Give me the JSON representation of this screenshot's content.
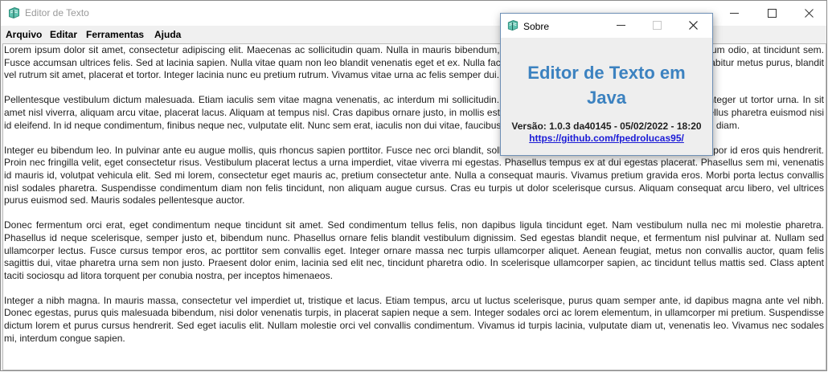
{
  "window": {
    "title": "Editor de Texto",
    "controls": {
      "minimize_icon": "minimize-icon",
      "maximize_icon": "maximize-icon",
      "close_icon": "close-icon"
    }
  },
  "menu": {
    "items": [
      "Arquivo",
      "Editar",
      "Ferramentas",
      "Ajuda"
    ]
  },
  "editor": {
    "paragraphs": [
      "Lorem ipsum dolor sit amet, consectetur adipiscing elit. Maecenas ac sollicitudin quam. Nulla in mauris bibendum, finibus libero in, maximus lorem. Sed et vestibulum odio, at tincidunt sem. Fusce accumsan ultrices felis. Sed at lacinia sapien. Nulla vitae quam non leo blandit venenatis eget et ex. Nulla facilisi. Vivamus iaculis semper maximus lorem. Curabitur metus purus, blandit vel rutrum sit amet, placerat et tortor. Integer lacinia nunc eu pretium rutrum. Vivamus vitae urna ac felis semper dui.",
      "Pellentesque vestibulum dictum malesuada. Etiam iaculis sem vitae magna venenatis, ac interdum mi sollicitudin. Nullam eu libero non dolor bibendum lobortis. Integer ut tortor urna. In sit amet nisl viverra, aliquam arcu vitae, placerat lacus. Aliquam at tempus nisl. Cras dapibus ornare justo, in mollis est. Aenean vel tellus mi. Phasellus mattis mi. Phasellus pharetra euismod nisi id eleifend. In id neque condimentum, finibus neque nec, vulputate elit. Nunc sem erat, iaculis non dui vitae, faucibus dignissim mi eros lectus. Pellentesque non mollis diam.",
      "Integer eu bibendum leo. In pulvinar ante eu augue mollis, quis rhoncus sapien porttitor. Fusce nec orci blandit, sollicitudin neque in, aliquam sem. Pellentesque tempor id eros quis hendrerit. Proin nec fringilla velit, eget consectetur risus. Vestibulum placerat lectus a urna imperdiet, vitae viverra mi egestas. Phasellus tempus ex at dui egestas placerat. Phasellus sem mi, venenatis id mauris id, volutpat vehicula elit. Sed mi lorem, consectetur eget mauris ac, pretium consectetur ante. Nulla a consequat mauris. Vivamus pretium gravida eros. Morbi porta lectus convallis nisl sodales pharetra. Suspendisse condimentum diam non felis tincidunt, non aliquam augue cursus. Cras eu turpis ut dolor scelerisque cursus. Aliquam consequat arcu libero, vel ultrices purus euismod sed. Mauris sodales pellentesque auctor.",
      "Donec fermentum orci erat, eget condimentum neque tincidunt sit amet. Sed condimentum tellus felis, non dapibus ligula tincidunt eget. Nam vestibulum nulla nec mi molestie pharetra. Phasellus id neque scelerisque, semper justo et, bibendum nunc. Phasellus ornare felis blandit vestibulum dignissim. Sed egestas blandit neque, et fermentum nisl pulvinar at. Nullam sed ullamcorper lectus. Fusce cursus tempor eros, ac porttitor sem convallis eget. Integer ornare massa nec turpis ullamcorper aliquet. Aenean feugiat, metus non convallis auctor, quam felis sagittis dui, vitae pharetra urna sem non justo. Praesent dolor enim, lacinia sed elit nec, tincidunt pharetra odio. In scelerisque ullamcorper sapien, ac tincidunt tellus mattis sed. Class aptent taciti sociosqu ad litora torquent per conubia nostra, per inceptos himenaeos.",
      "Integer a nibh magna. In mauris massa, consectetur vel imperdiet ut, tristique et lacus. Etiam tempus, arcu ut luctus scelerisque, purus quam semper ante, id dapibus magna ante vel nibh. Donec egestas, purus quis malesuada bibendum, nisi dolor venenatis turpis, in placerat sapien neque a sem. Integer sodales orci ac lorem elementum, in ullamcorper mi pretium. Suspendisse dictum lorem et purus cursus hendrerit. Sed eget iaculis elit. Nullam molestie orci vel convallis condimentum. Vivamus id turpis lacinia, vulputate diam ut, venenatis leo. Vivamus nec sodales mi, interdum congue sapien."
    ]
  },
  "about_dialog": {
    "title": "Sobre",
    "heading_line1": "Editor de Texto em",
    "heading_line2": "Java",
    "version_text": "Versão: 1.0.3 da40145 - 05/02/2022 - 18:20",
    "link_text": "https://github.com/fpedrolucas95/",
    "heading_color": "#3c82c0",
    "link_color": "#1a1ad6"
  }
}
